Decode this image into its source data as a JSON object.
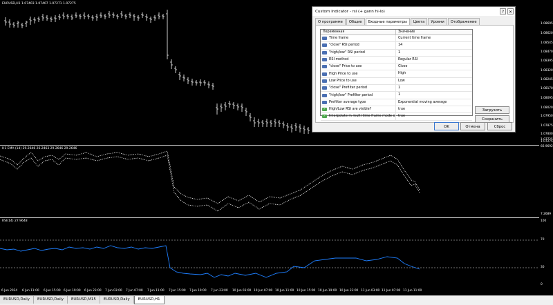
{
  "panes": {
    "main_label": "EURUSD,H1  1.07403 1.07407 1.07271 1.07275",
    "ind1_label": "H1 EMA (14) 29.2646 26.2463 29.2646 29.2646",
    "ind2_label": "RSI(14) 27.9648"
  },
  "price_axis": {
    "main": [
      "1.08695",
      "1.08620",
      "1.08545",
      "1.08470",
      "1.08395",
      "1.08320",
      "1.08245",
      "1.08170",
      "1.08095",
      "1.08020",
      "1.07950",
      "1.07875",
      "1.07800",
      "1.07725",
      "1.07275"
    ],
    "ind1_top": "66.9692",
    "ind1_bottom": "7.2689",
    "ind2_top": "100",
    "ind2_level70": "70",
    "ind2_level30": "30",
    "ind2_bottom": "0"
  },
  "time_axis": [
    "6 Jun 2024",
    "6 Jun 11:00",
    "6 Jun 15:00",
    "6 Jun 19:00",
    "6 Jun 23:00",
    "7 Jun 03:00",
    "7 Jun 07:00",
    "7 Jun 11:00",
    "7 Jun 15:00",
    "7 Jun 19:00",
    "7 Jun 23:00",
    "10 Jun 03:00",
    "10 Jun 07:00",
    "10 Jun 11:00",
    "10 Jun 15:00",
    "10 Jun 19:00",
    "10 Jun 23:00",
    "11 Jun 03:00",
    "11 Jun 07:00",
    "11 Jun 11:00"
  ],
  "dialog": {
    "title": "Custom Indicator - rsi (+ gann hi-lo)",
    "help_glyph": "?",
    "close_glyph": "✕",
    "tabs": [
      "О программе",
      "Общие",
      "Входные параметры",
      "Цвета",
      "Уровни",
      "Отображение"
    ],
    "active_tab_index": 2,
    "grid": {
      "col_name": "Переменная",
      "col_value": "Значение",
      "rows": [
        {
          "icon": "int",
          "name": "Time frame",
          "value": "Current time frame"
        },
        {
          "icon": "int",
          "name": "\"close\" RSI period",
          "value": "14"
        },
        {
          "icon": "int",
          "name": "\"high/low\" RSI period",
          "value": "1"
        },
        {
          "icon": "int",
          "name": "RSI method",
          "value": "Regular RSI"
        },
        {
          "icon": "int",
          "name": "\"close\" Price to use",
          "value": "Close"
        },
        {
          "icon": "int",
          "name": "High Price to use",
          "value": "High"
        },
        {
          "icon": "int",
          "name": "Low Price to use",
          "value": "Low"
        },
        {
          "icon": "int",
          "name": "\"close\" Prefilter period",
          "value": "1"
        },
        {
          "icon": "int",
          "name": "\"high/low\" Prefilter period",
          "value": "1"
        },
        {
          "icon": "int",
          "name": "Prefilter average type",
          "value": "Exponential moving average"
        },
        {
          "icon": "bool",
          "name": "High/Low RSI  are visible?",
          "value": "true"
        },
        {
          "icon": "bool",
          "name": "Interpolate in multi time frame mode on/o...",
          "value": "true"
        }
      ]
    },
    "load_label": "Загрузить",
    "save_label": "Сохранить",
    "ok_label": "OK",
    "cancel_label": "Отмена",
    "reset_label": "Сброс"
  },
  "bottom_tabs": [
    "EURUSD,Daily",
    "EURUSD,Daily",
    "EURUSD,M15",
    "EURUSD,Daily",
    "EURUSD,H1"
  ],
  "active_bottom_tab": 4,
  "colors": {
    "candle": "#ffffff",
    "indicator_dots": "#ffffff",
    "rsi_line": "#1e7fff",
    "level_line": "#9a9a9a"
  }
}
